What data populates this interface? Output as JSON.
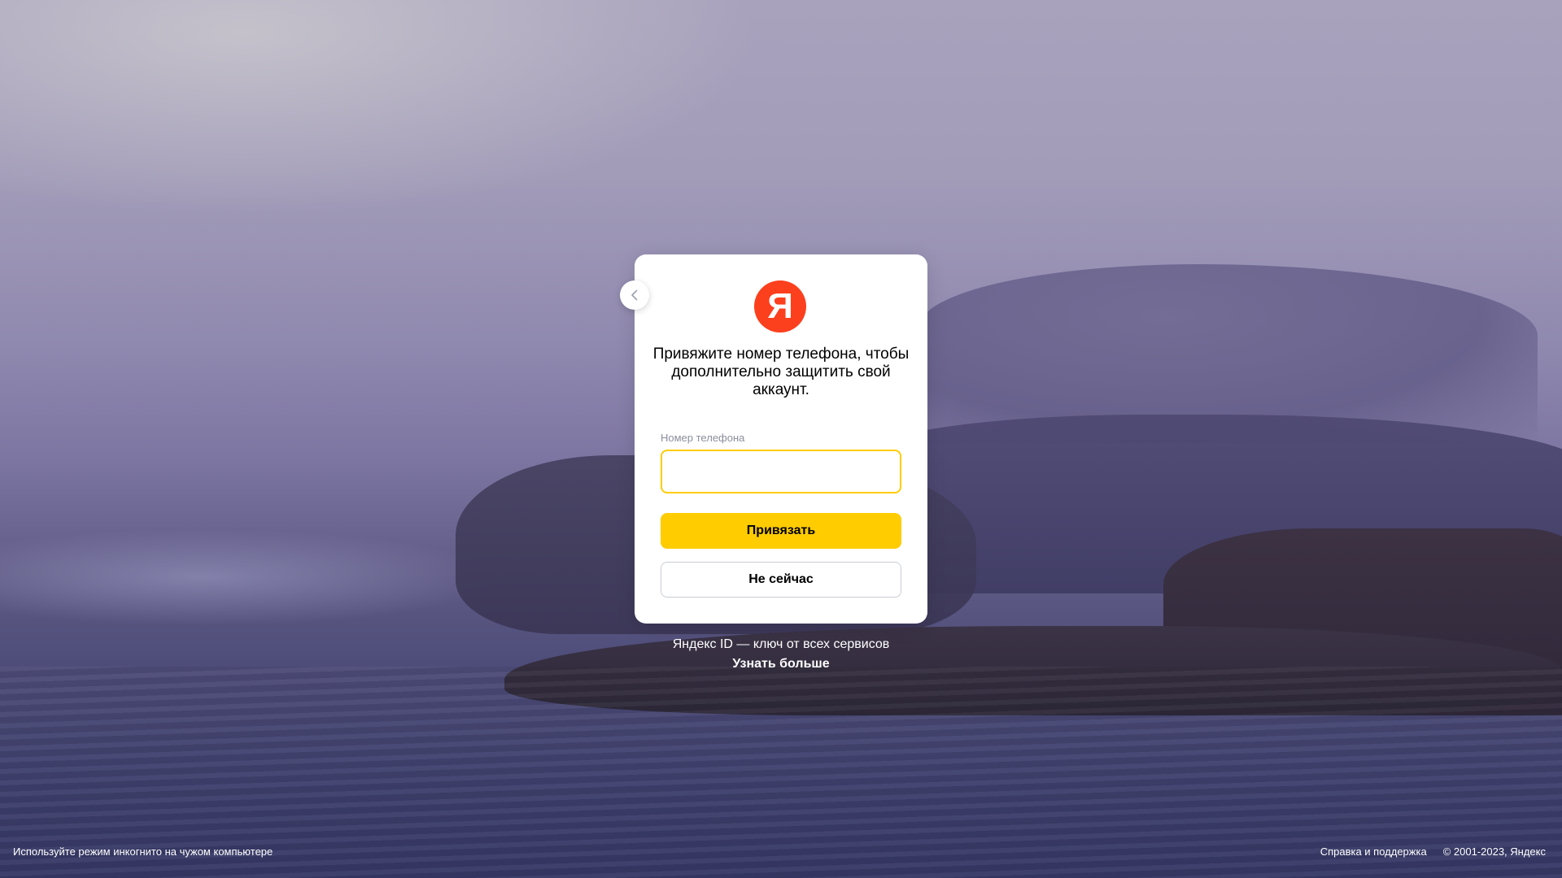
{
  "brand": {
    "logo_letter": "Я",
    "accent_color": "#fc3f1d",
    "button_color": "#ffcc00"
  },
  "dialog": {
    "title": "Привяжите номер телефона, чтобы дополнительно защитить свой аккаунт.",
    "phone_label": "Номер телефона",
    "phone_value": "",
    "bind_button": "Привязать",
    "skip_button": "Не сейчас",
    "back_icon": "chevron-left-icon"
  },
  "promo": {
    "text": "Яндекс ID — ключ от всех сервисов",
    "link": "Узнать больше"
  },
  "footer": {
    "incognito_hint": "Используйте режим инкогнито на чужом компьютере",
    "help_link": "Справка и поддержка",
    "copyright": "© 2001-2023, Яндекс"
  }
}
